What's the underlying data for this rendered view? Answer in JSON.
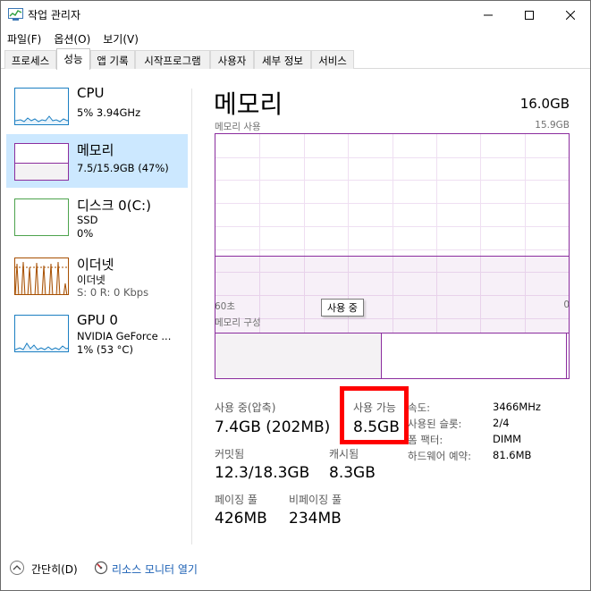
{
  "window": {
    "title": "작업 관리자"
  },
  "menu": [
    "파일(F)",
    "옵션(O)",
    "보기(V)"
  ],
  "tabs": [
    "프로세스",
    "성능",
    "앱 기록",
    "시작프로그램",
    "사용자",
    "세부 정보",
    "서비스"
  ],
  "sidebar": {
    "cpu": {
      "name": "CPU",
      "detail": "5% 3.94GHz"
    },
    "memory": {
      "name": "메모리",
      "detail": "7.5/15.9GB (47%)"
    },
    "disk": {
      "name": "디스크 0(C:)",
      "type": "SSD",
      "detail": "0%"
    },
    "ethernet": {
      "name": "이더넷",
      "type": "이더넷",
      "detail": "S: 0 R: 0 Kbps"
    },
    "gpu": {
      "name": "GPU 0",
      "type": "NVIDIA GeForce ...",
      "detail": "1% (53 °C)"
    }
  },
  "main": {
    "title": "메모리",
    "total": "16.0GB",
    "usage_label": "메모리 사용",
    "usage_max": "15.9GB",
    "usage_fraction": 0.47,
    "x_left": "60초",
    "x_right": "0",
    "tooltip": "사용 중",
    "composition_label": "메모리 구성",
    "composition_used_fraction": 0.47
  },
  "stats": {
    "in_use_label": "사용 중(압축)",
    "in_use_value": "7.4GB (202MB)",
    "available_label": "사용 가능",
    "available_value": "8.5GB",
    "committed_label": "커밋됨",
    "committed_value": "12.3/18.3GB",
    "cached_label": "캐시됨",
    "cached_value": "8.3GB",
    "paged_label": "페이징 풀",
    "paged_value": "426MB",
    "nonpaged_label": "비페이징 풀",
    "nonpaged_value": "234MB"
  },
  "specs": [
    {
      "label": "속도:",
      "value": "3466MHz"
    },
    {
      "label": "사용된 슬롯:",
      "value": "2/4"
    },
    {
      "label": "폼 팩터:",
      "value": "DIMM"
    },
    {
      "label": "하드웨어 예약:",
      "value": "81.6MB"
    }
  ],
  "footer": {
    "fewer_details": "간단히(D)",
    "resource_monitor": "리소스 모니터 열기"
  },
  "colors": {
    "memory_accent": "#8b2d9e",
    "cpu_accent": "#1c7fc2",
    "ethernet_accent": "#a74f01",
    "selection": "#cce8ff",
    "highlight": "#ff0000"
  }
}
